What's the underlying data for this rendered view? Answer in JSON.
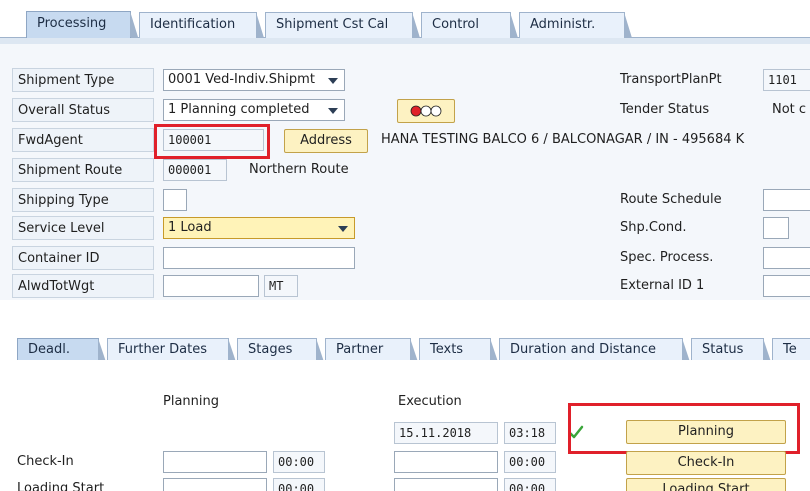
{
  "top_tabs": [
    "Processing",
    "Identification",
    "Shipment Cst Cal",
    "Control",
    "Administr."
  ],
  "fields": {
    "shipment_type": {
      "label": "Shipment Type",
      "value": "0001 Ved-Indiv.Shipmt"
    },
    "overall_status": {
      "label": "Overall Status",
      "value": "1 Planning completed"
    },
    "fwd_agent": {
      "label": "FwdAgent",
      "value": "100001",
      "address_button": "Address",
      "address_text": "HANA TESTING BALCO 6 / BALCONAGAR / IN - 495684 K"
    },
    "shipment_route": {
      "label": "Shipment Route",
      "value": "000001",
      "description": "Northern Route"
    },
    "shipping_type": {
      "label": "Shipping Type",
      "value": ""
    },
    "service_level": {
      "label": "Service Level",
      "value": "1 Load"
    },
    "container_id": {
      "label": "Container ID",
      "value": ""
    },
    "alwd_tot_wgt": {
      "label": "AlwdTotWgt",
      "value": "",
      "unit": "MT"
    },
    "transport_plan_pt": {
      "label": "TransportPlanPt",
      "value": "1101"
    },
    "tender_status": {
      "label": "Tender Status",
      "value": "Not c"
    },
    "route_schedule": {
      "label": "Route Schedule",
      "value": ""
    },
    "shp_cond": {
      "label": "Shp.Cond.",
      "value": ""
    },
    "spec_process": {
      "label": "Spec. Process.",
      "value": ""
    },
    "external_id_1": {
      "label": "External ID 1",
      "value": ""
    }
  },
  "lower_tabs": [
    "Deadl.",
    "Further Dates",
    "Stages",
    "Partner",
    "Texts",
    "Duration and Distance",
    "Status",
    "Te"
  ],
  "deadlines": {
    "col_planning": "Planning",
    "col_execution": "Execution",
    "top_exec_date": "15.11.2018",
    "top_exec_time": "03:18",
    "top_button": "Planning",
    "rows": [
      {
        "label": "Check-In",
        "plan_time": "00:00",
        "exec_time": "00:00",
        "button": "Check-In"
      },
      {
        "label": "Loading Start",
        "plan_time": "00:00",
        "exec_time": "00:00",
        "button": "Loading Start"
      }
    ]
  },
  "colors": {
    "accent_red": "#e0202a",
    "button_yellow": "#fdf2c2",
    "field_yellow": "#fff3b8",
    "check_green": "#3aa53a"
  }
}
